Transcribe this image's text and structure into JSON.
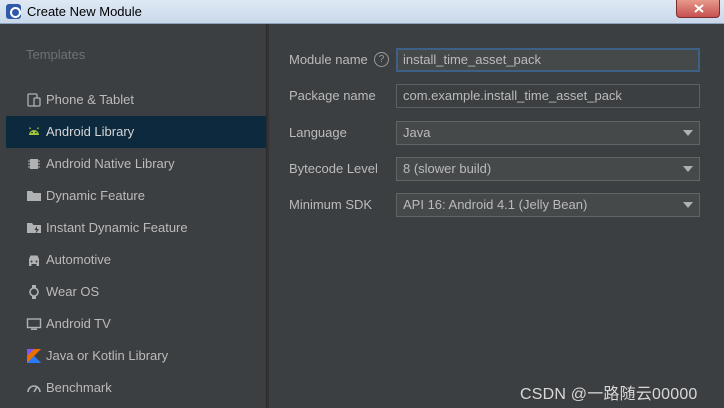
{
  "window": {
    "title": "Create New Module"
  },
  "sidebar": {
    "header": "Templates",
    "items": [
      {
        "label": "Phone & Tablet",
        "icon": "phone-tablet-icon",
        "selected": false
      },
      {
        "label": "Android Library",
        "icon": "android-icon",
        "selected": true
      },
      {
        "label": "Android Native Library",
        "icon": "chip-icon",
        "selected": false
      },
      {
        "label": "Dynamic Feature",
        "icon": "folder-icon",
        "selected": false
      },
      {
        "label": "Instant Dynamic Feature",
        "icon": "folder-bolt-icon",
        "selected": false
      },
      {
        "label": "Automotive",
        "icon": "car-icon",
        "selected": false
      },
      {
        "label": "Wear OS",
        "icon": "watch-icon",
        "selected": false
      },
      {
        "label": "Android TV",
        "icon": "tv-icon",
        "selected": false
      },
      {
        "label": "Java or Kotlin Library",
        "icon": "kotlin-icon",
        "selected": false
      },
      {
        "label": "Benchmark",
        "icon": "benchmark-icon",
        "selected": false
      }
    ]
  },
  "form": {
    "module_name": {
      "label": "Module name",
      "value": "install_time_asset_pack",
      "help_icon": "?"
    },
    "package_name": {
      "label": "Package name",
      "value": "com.example.install_time_asset_pack"
    },
    "language": {
      "label": "Language",
      "value": "Java"
    },
    "bytecode_level": {
      "label": "Bytecode Level",
      "value": "8 (slower build)"
    },
    "minimum_sdk": {
      "label": "Minimum SDK",
      "value": "API 16: Android 4.1 (Jelly Bean)"
    }
  },
  "watermark": "CSDN @一路随云00000",
  "colors": {
    "background": "#3c3f41",
    "selection": "#0d293e",
    "android_green": "#a4c639",
    "focus_border": "#3d6185",
    "close_red": "#c75050"
  }
}
